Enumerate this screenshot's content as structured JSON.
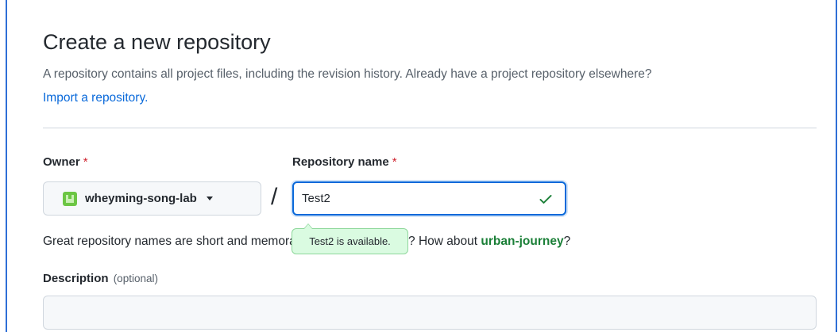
{
  "page": {
    "title": "Create a new repository",
    "subtitle": "A repository contains all project files, including the revision history. Already have a project repository elsewhere?",
    "import_link": "Import a repository."
  },
  "owner": {
    "label": "Owner",
    "required_mark": "*",
    "value": "wheyming-song-lab",
    "icon": "org-avatar-icon"
  },
  "separator": "/",
  "repo_name": {
    "label": "Repository name",
    "required_mark": "*",
    "value": "Test2",
    "status_icon": "check-icon",
    "availability_tooltip": "Test2 is available."
  },
  "hint": {
    "text_before": "Great repository names are short and memorable. Need inspiration? How about ",
    "suggestion": "urban-journey",
    "text_after": "?"
  },
  "description": {
    "label": "Description",
    "optional_note": "(optional)",
    "value": ""
  },
  "colors": {
    "accent": "#0969da",
    "success": "#1a7f37",
    "required": "#cf222e",
    "tooltip_bg": "#dafbe1"
  }
}
